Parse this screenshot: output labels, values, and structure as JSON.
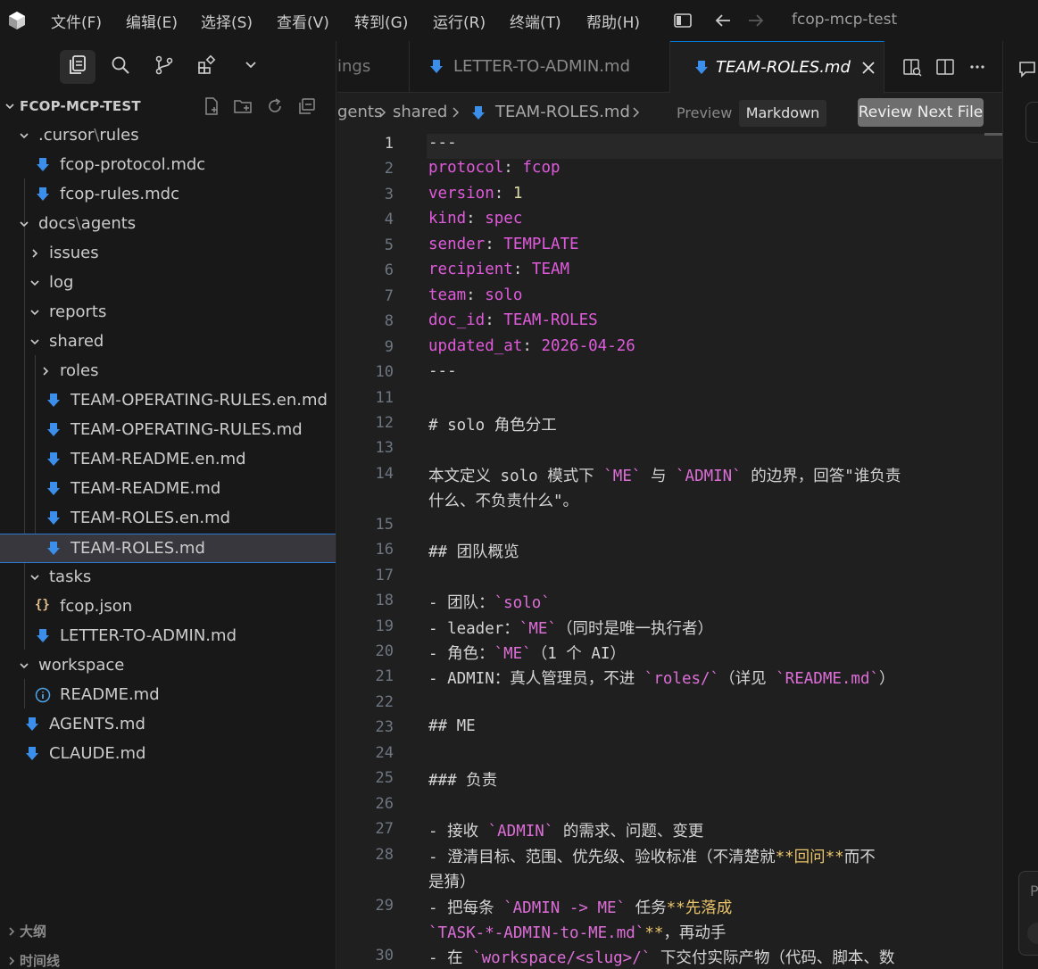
{
  "titlebar": {
    "menus": [
      "文件(F)",
      "编辑(E)",
      "选择(S)",
      "查看(V)",
      "转到(G)",
      "运行(R)",
      "终端(T)",
      "帮助(H)"
    ],
    "window_title": "fcop-mcp-test"
  },
  "explorer": {
    "title": "FCOP-MCP-TEST",
    "tree": [
      {
        "label": "cursor",
        "prefix": ".",
        "suffix": "rules",
        "kind": "folder",
        "state": "open"
      },
      {
        "label": "fcop-protocol.mdc",
        "kind": "md"
      },
      {
        "label": "fcop-rules.mdc",
        "kind": "md"
      },
      {
        "label": "docs",
        "suffix": "agents",
        "kind": "folder",
        "state": "open"
      },
      {
        "label": "issues",
        "kind": "folder",
        "state": "closed"
      },
      {
        "label": "log",
        "kind": "folder",
        "state": "open"
      },
      {
        "label": "reports",
        "kind": "folder",
        "state": "open"
      },
      {
        "label": "shared",
        "kind": "folder",
        "state": "open"
      },
      {
        "label": "roles",
        "kind": "folder",
        "state": "closed"
      },
      {
        "label": "TEAM-OPERATING-RULES.en.md",
        "kind": "md"
      },
      {
        "label": "TEAM-OPERATING-RULES.md",
        "kind": "md"
      },
      {
        "label": "TEAM-README.en.md",
        "kind": "md"
      },
      {
        "label": "TEAM-README.md",
        "kind": "md"
      },
      {
        "label": "TEAM-ROLES.en.md",
        "kind": "md"
      },
      {
        "label": "TEAM-ROLES.md",
        "kind": "md",
        "selected": true
      },
      {
        "label": "tasks",
        "kind": "folder",
        "state": "open"
      },
      {
        "label": "fcop.json",
        "kind": "json"
      },
      {
        "label": "LETTER-TO-ADMIN.md",
        "kind": "md"
      },
      {
        "label": "workspace",
        "kind": "folder",
        "state": "open"
      },
      {
        "label": "README.md",
        "kind": "info"
      },
      {
        "label": "AGENTS.md",
        "kind": "md"
      },
      {
        "label": "CLAUDE.md",
        "kind": "md"
      }
    ],
    "outline_label": "大纲",
    "timeline_label": "时间线"
  },
  "tabs": [
    {
      "label": "ings"
    },
    {
      "label": "LETTER-TO-ADMIN.md"
    },
    {
      "label": "TEAM-ROLES.md",
      "active": true
    }
  ],
  "breadcrumb": {
    "parts": [
      "gents",
      "shared",
      "TEAM-ROLES.md"
    ],
    "preview_label": "Preview",
    "markdown_label": "Markdown",
    "review_next_label": "Review Next File"
  },
  "editor": {
    "current_line": 1,
    "lines": [
      {
        "n": "1",
        "t": "---"
      },
      {
        "n": "2",
        "k": "protocol",
        "v": "fcop"
      },
      {
        "n": "3",
        "k": "version",
        "num": "1"
      },
      {
        "n": "4",
        "k": "kind",
        "v": "spec"
      },
      {
        "n": "5",
        "k": "sender",
        "v": "TEMPLATE"
      },
      {
        "n": "6",
        "k": "recipient",
        "v": "TEAM"
      },
      {
        "n": "7",
        "k": "team",
        "v": "solo"
      },
      {
        "n": "8",
        "k": "doc_id",
        "v": "TEAM-ROLES"
      },
      {
        "n": "9",
        "k": "updated_at",
        "v": "2026-04-26"
      },
      {
        "n": "10",
        "t": "---"
      },
      {
        "n": "11",
        "t": ""
      },
      {
        "n": "12",
        "t": "# solo 角色分工"
      },
      {
        "n": "13",
        "t": ""
      },
      {
        "n": "14",
        "parts": [
          [
            "",
            "本文定义 solo 模式下 "
          ],
          [
            "ic",
            "`ME`"
          ],
          [
            "",
            " 与 "
          ],
          [
            "ic",
            "`ADMIN`"
          ],
          [
            "",
            " 的边界，回答\"谁负责"
          ]
        ]
      },
      {
        "n": "",
        "t": "什么、不负责什么\"。"
      },
      {
        "n": "15",
        "t": ""
      },
      {
        "n": "16",
        "t": "## 团队概览"
      },
      {
        "n": "17",
        "t": ""
      },
      {
        "n": "18",
        "parts": [
          [
            "",
            "- 团队："
          ],
          [
            "ic",
            "`solo`"
          ]
        ]
      },
      {
        "n": "19",
        "parts": [
          [
            "",
            "- leader："
          ],
          [
            "ic",
            "`ME`"
          ],
          [
            "",
            "（同时是唯一执行者）"
          ]
        ]
      },
      {
        "n": "20",
        "parts": [
          [
            "",
            "- 角色："
          ],
          [
            "ic",
            "`ME`"
          ],
          [
            "",
            "（1 个 AI）"
          ]
        ]
      },
      {
        "n": "21",
        "parts": [
          [
            "",
            "- ADMIN：真人管理员，不进 "
          ],
          [
            "ic",
            "`roles/`"
          ],
          [
            "",
            "（详见 "
          ],
          [
            "ic",
            "`README.md`"
          ],
          [
            "",
            "）"
          ]
        ]
      },
      {
        "n": "22",
        "t": ""
      },
      {
        "n": "23",
        "t": "## ME"
      },
      {
        "n": "24",
        "t": ""
      },
      {
        "n": "25",
        "t": "### 负责"
      },
      {
        "n": "26",
        "t": ""
      },
      {
        "n": "27",
        "parts": [
          [
            "",
            "- 接收 "
          ],
          [
            "ic",
            "`ADMIN`"
          ],
          [
            "",
            " 的需求、问题、变更"
          ]
        ]
      },
      {
        "n": "28",
        "parts": [
          [
            "",
            "- 澄清目标、范围、优先级、验收标准（不清楚就"
          ],
          [
            "bold",
            "**回问**"
          ],
          [
            "",
            "而不"
          ]
        ]
      },
      {
        "n": "",
        "t": "是猜）"
      },
      {
        "n": "29",
        "parts": [
          [
            "",
            "- 把每条 "
          ],
          [
            "ic",
            "`ADMIN -> ME`"
          ],
          [
            "",
            " 任务"
          ],
          [
            "bold",
            "**先落成"
          ]
        ]
      },
      {
        "n": "",
        "parts": [
          [
            "ic",
            "`TASK-*-ADMIN-to-ME.md`"
          ],
          [
            "bold",
            "**"
          ],
          [
            "",
            "，再动手"
          ]
        ]
      },
      {
        "n": "30",
        "parts": [
          [
            "",
            "- 在 "
          ],
          [
            "ic",
            "`workspace/<slug>/`"
          ],
          [
            "",
            " 下交付实际产物（代码、脚本、数"
          ]
        ]
      }
    ]
  },
  "right_panel": {
    "placeholder_initial": "P"
  },
  "colors": {
    "accent": "#0078d4",
    "md_icon": "#3b8eea",
    "yaml_key": "#e05bdb",
    "yaml_value": "#e05bdb",
    "inline_code": "#dd6ed8",
    "bold_text": "#e9c46a"
  }
}
